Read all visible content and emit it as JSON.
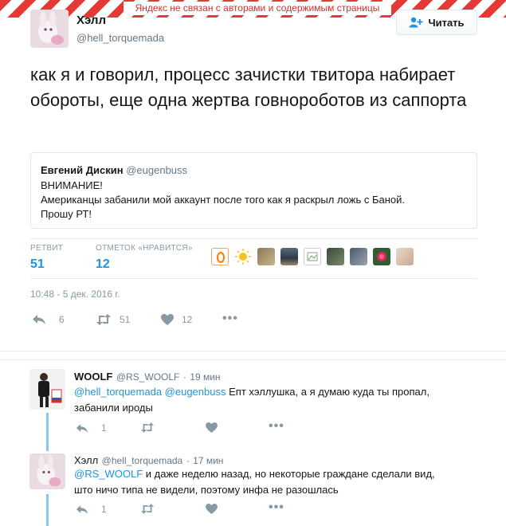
{
  "banner": {
    "text": "Яндекс не связан с авторами и содержимым страницы"
  },
  "main_tweet": {
    "author_name": "Хэлл",
    "author_handle": "@hell_torquemada",
    "follow_label": "Читать",
    "text": "как я и говорил, процесс зачистки твитора набирает обороты, еще одна жертва говнороботов из саппорта",
    "quote": {
      "author_name": "Евгений Дискин",
      "author_handle": "@eugenbuss",
      "line1": "ВНИМАНИЕ!",
      "line2": "Американцы забанили мой аккаунт после того как я раскрыл ложь с Баной.",
      "line3": "Прошу РТ!"
    },
    "stats": {
      "retweets_label": "РЕТВИТ",
      "retweets_value": "51",
      "likes_label": "ОТМЕТОК «НРАВИТСЯ»",
      "likes_value": "12"
    },
    "timestamp": "10:48 - 5 дек. 2016 г.",
    "actions": {
      "reply_count": "6",
      "retweet_count": "51",
      "like_count": "12",
      "more": "•••"
    }
  },
  "replies": [
    {
      "author_name": "WOOLF",
      "author_handle": "@RS_WOOLF",
      "sep": "·",
      "time": "19 мин",
      "mention1": "@hell_torquemada",
      "mention2": "@eugenbuss",
      "text_line1": "Епт хэллушка, а я думаю куда ты пропал,",
      "text_line2": "забанили ироды",
      "reply_count": "1",
      "more": "•••"
    },
    {
      "author_name": "Хэлл",
      "author_handle": "@hell_torquemada",
      "sep": "·",
      "time": "17 мин",
      "mention1": "@RS_WOOLF",
      "text_line1": "и даже неделю назад, но некоторые граждане сделали вид,",
      "text_line2": "што ничо типа не видели, поэтому инфа не разошлась",
      "reply_count": "1",
      "more": "•••"
    }
  ],
  "colors": {
    "accent": "#1b95e0",
    "muted": "#8899a6",
    "banner_red": "#d32f2f",
    "thread": "#86c7ee"
  }
}
